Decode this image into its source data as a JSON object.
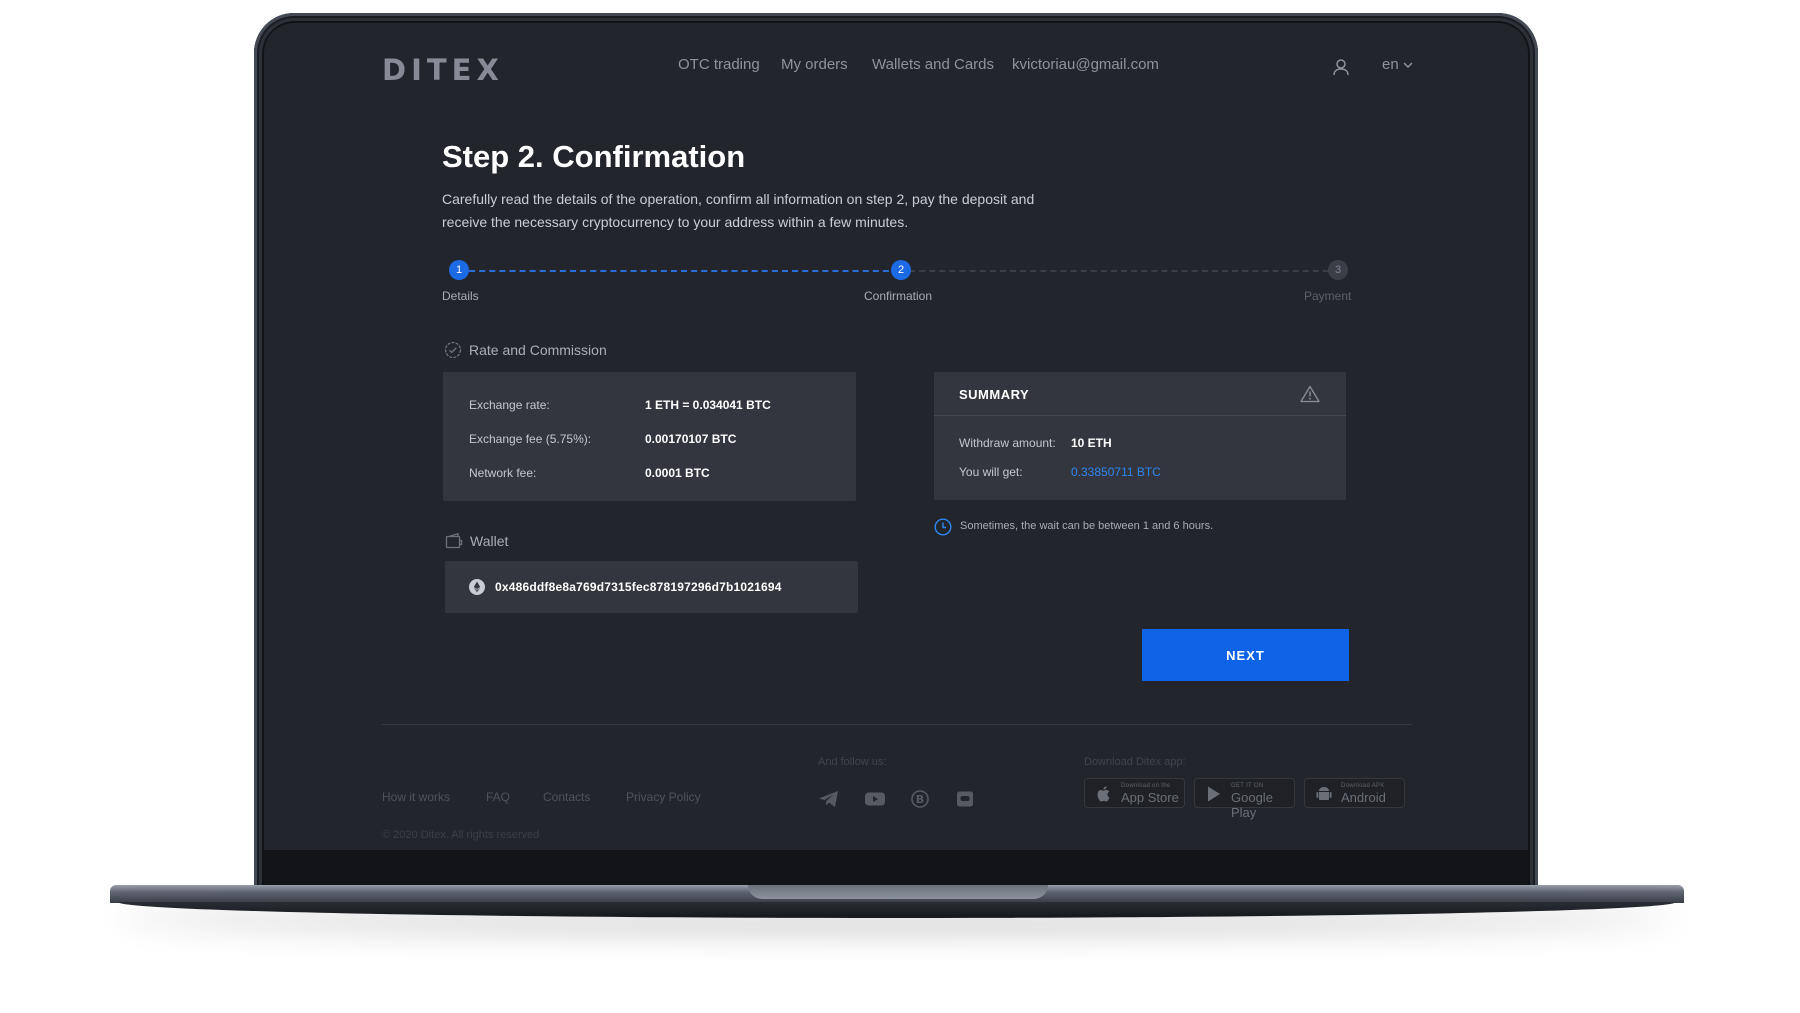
{
  "header": {
    "logo": "DITEX",
    "nav": [
      "OTC trading",
      "My orders",
      "Wallets and Cards"
    ],
    "user_email": "kvictoriau@gmail.com",
    "lang": "en"
  },
  "page": {
    "title": "Step 2. Confirmation",
    "description": "Carefully read the details of the operation, confirm all information on step 2, pay the deposit and receive the necessary cryptocurrency to your address within a few minutes."
  },
  "stepper": {
    "steps": [
      {
        "number": "1",
        "label": "Details",
        "state": "done"
      },
      {
        "number": "2",
        "label": "Confirmation",
        "state": "active"
      },
      {
        "number": "3",
        "label": "Payment",
        "state": "pending"
      }
    ]
  },
  "rate": {
    "section_label": "Rate and Commission",
    "rows": [
      {
        "key": "Exchange rate:",
        "value": "1 ETH = 0.034041 BTC"
      },
      {
        "key": "Exchange fee (5.75%):",
        "value": "0.00170107 BTC"
      },
      {
        "key": "Network fee:",
        "value": "0.0001 BTC"
      }
    ]
  },
  "summary": {
    "title": "SUMMARY",
    "withdraw_label": "Withdraw amount:",
    "withdraw_value": "10 ETH",
    "get_label": "You will get:",
    "get_value": "0.33850711 BTC",
    "wait_note": "Sometimes, the wait can be between 1 and 6 hours."
  },
  "wallet": {
    "section_label": "Wallet",
    "address": "0x486ddf8e8a769d7315fec878197296d7b1021694"
  },
  "actions": {
    "next_label": "NEXT"
  },
  "footer": {
    "links": [
      "How it works",
      "FAQ",
      "Contacts",
      "Privacy Policy"
    ],
    "follow_caption": "And follow us:",
    "download_caption": "Download Ditex app:",
    "stores": [
      {
        "small": "Download on the",
        "big": "App Store"
      },
      {
        "small": "GET IT ON",
        "big": "Google Play"
      },
      {
        "small": "Download APK",
        "big": "Android"
      }
    ],
    "copyright": "© 2020 Ditex. All rights reserved"
  },
  "colors": {
    "accent": "#0e63e6",
    "link": "#2d86f0",
    "background": "#23252d",
    "panel": "#33363e"
  }
}
